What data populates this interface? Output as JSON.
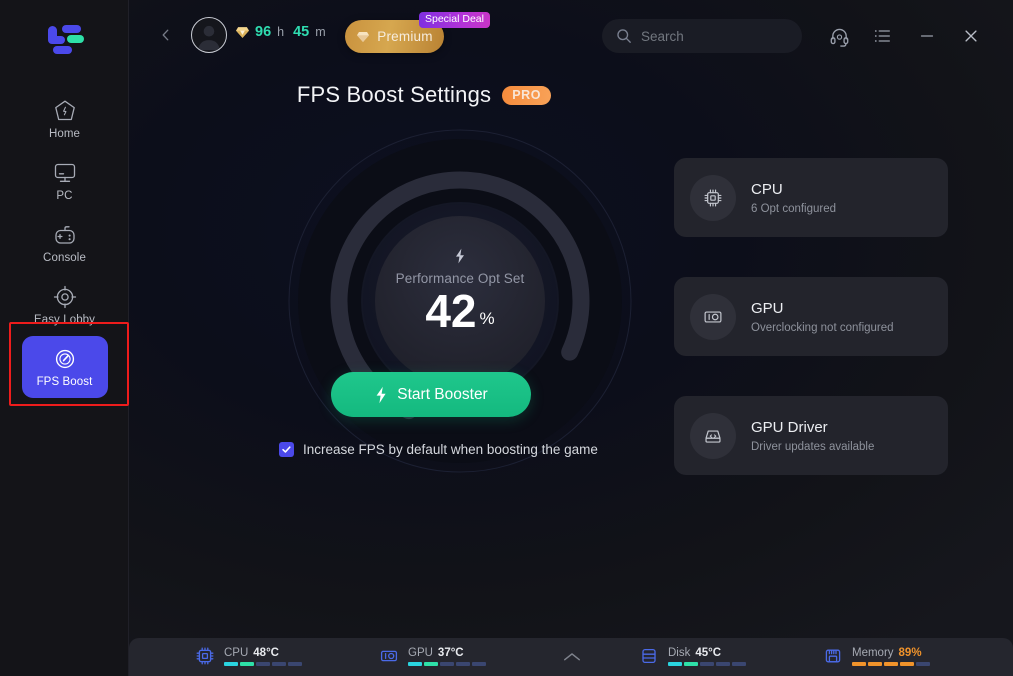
{
  "app": {
    "background_color": "#16171d",
    "accent_blue": "#4b49ea",
    "accent_green": "#14b97f"
  },
  "sidebar": {
    "logo_name": "logo-lagofast",
    "items": [
      {
        "label": "Home",
        "icon": "home-icon",
        "active": false
      },
      {
        "label": "PC",
        "icon": "monitor-icon",
        "active": false
      },
      {
        "label": "Console",
        "icon": "gamepad-icon",
        "active": false
      },
      {
        "label": "Easy Lobby",
        "icon": "crosshair-icon",
        "active": false
      },
      {
        "label": "FPS Boost",
        "icon": "speedometer-icon",
        "active": true
      }
    ]
  },
  "topbar": {
    "back_icon": "chevron-left-icon",
    "avatar_icon": "user-avatar-icon",
    "gem_icon": "gem-icon",
    "time": {
      "hours": "96",
      "hours_unit": "h",
      "minutes": "45",
      "minutes_unit": "m"
    },
    "premium": {
      "label": "Premium",
      "icon": "gem-icon"
    },
    "special_deal_badge": "Special Deal",
    "search": {
      "placeholder": "Search",
      "value": "",
      "icon": "search-icon"
    },
    "icons": {
      "support": "headset-icon",
      "menu": "list-icon",
      "minimize": "minimize-icon",
      "close": "close-icon"
    }
  },
  "page": {
    "title": "FPS Boost Settings",
    "pro_badge": "PRO"
  },
  "gauge": {
    "bolt_icon": "bolt-icon",
    "label": "Performance Opt Set",
    "value": "42",
    "unit": "%"
  },
  "cards": [
    {
      "title": "CPU",
      "subtitle": "6 Opt configured",
      "icon": "cpu-chip-icon"
    },
    {
      "title": "GPU",
      "subtitle": "Overclocking not configured",
      "icon": "gpu-card-icon"
    },
    {
      "title": "GPU Driver",
      "subtitle": "Driver updates available",
      "icon": "driver-disk-icon"
    }
  ],
  "actions": {
    "start_booster": {
      "label": "Start Booster",
      "icon": "bolt-icon"
    },
    "checkbox": {
      "label": "Increase FPS by default when boosting the game",
      "checked": true
    }
  },
  "statusbar": {
    "collapse_icon": "chevron-up-icon",
    "stats": [
      {
        "name": "CPU",
        "value": "48°C",
        "icon": "cpu-chip-icon",
        "warn": false,
        "lit": 2,
        "total": 5
      },
      {
        "name": "GPU",
        "value": "37°C",
        "icon": "gpu-card-icon",
        "warn": false,
        "lit": 2,
        "total": 5
      },
      {
        "name": "Disk",
        "value": "45°C",
        "icon": "disk-icon",
        "warn": false,
        "lit": 2,
        "total": 5
      },
      {
        "name": "Memory",
        "value": "89%",
        "icon": "memory-icon",
        "warn": true,
        "lit": 4,
        "total": 5
      }
    ]
  }
}
